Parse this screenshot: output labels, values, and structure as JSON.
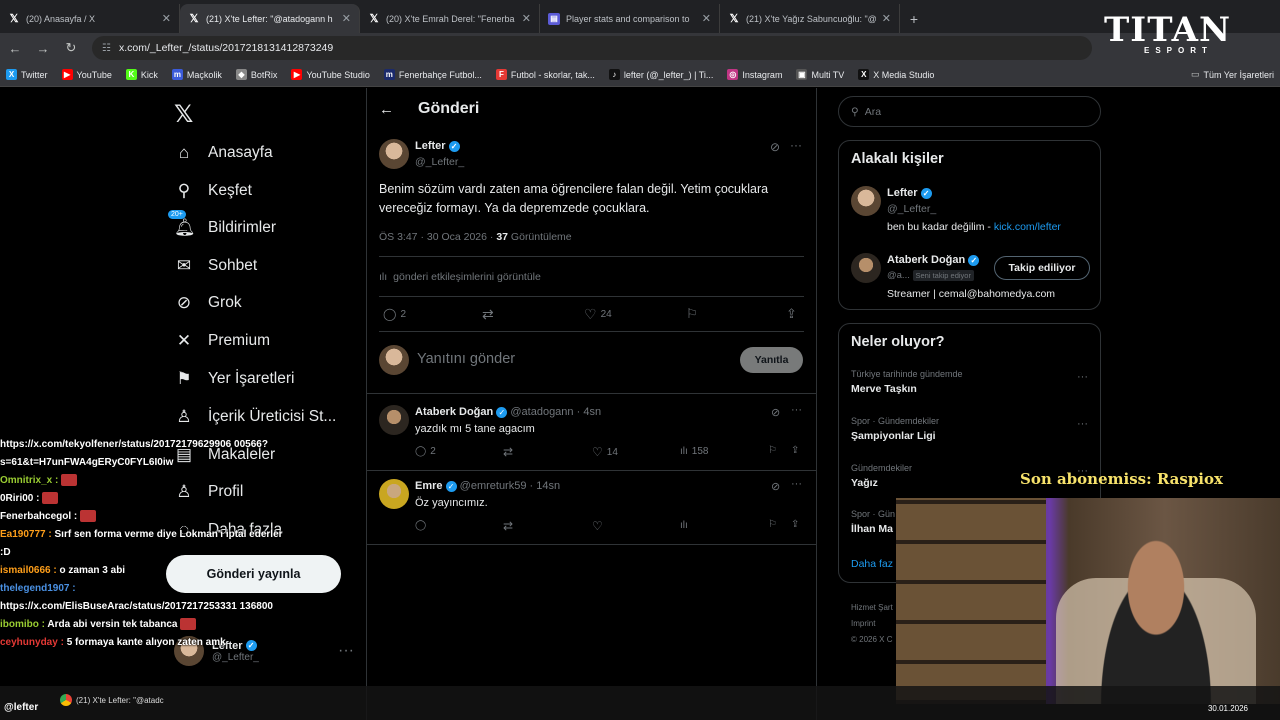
{
  "browser": {
    "tabs": [
      {
        "title": "(20) Anasayfa / X",
        "icon": "x-icon",
        "active": false
      },
      {
        "title": "(21) X'te Lefter: \"@atadogann h",
        "icon": "x-icon",
        "active": true
      },
      {
        "title": "(20) X'te Emrah Derel: \"Fenerba",
        "icon": "x-icon",
        "active": false
      },
      {
        "title": "Player stats and comparison to",
        "icon": "stats-icon",
        "active": false
      },
      {
        "title": "(21) X'te Yağız Sabuncuoğlu: \"@",
        "icon": "x-icon",
        "active": false
      }
    ],
    "url": "x.com/_Lefter_/status/2017218131412873249",
    "bookmarks": [
      {
        "label": "Twitter",
        "color": "#1d9bf0",
        "glyph": "X"
      },
      {
        "label": "YouTube",
        "color": "#ff0000",
        "glyph": "▶"
      },
      {
        "label": "Kick",
        "color": "#53fc18",
        "glyph": "K"
      },
      {
        "label": "Maçkolik",
        "color": "#3b5bdb",
        "glyph": "m"
      },
      {
        "label": "BotRix",
        "color": "#888888",
        "glyph": "◆"
      },
      {
        "label": "YouTube Studio",
        "color": "#ff0000",
        "glyph": "▶"
      },
      {
        "label": "Fenerbahçe Futbol...",
        "color": "#1b2a6b",
        "glyph": "m"
      },
      {
        "label": "Futbol - skorlar, tak...",
        "color": "#e53935",
        "glyph": "F"
      },
      {
        "label": "lefter (@_lefter_) | Ti...",
        "color": "#111111",
        "glyph": "♪"
      },
      {
        "label": "Instagram",
        "color": "#c13584",
        "glyph": "◎"
      },
      {
        "label": "Multi TV",
        "color": "#555555",
        "glyph": "▣"
      },
      {
        "label": "X Media Studio",
        "color": "#111111",
        "glyph": "X"
      }
    ],
    "bookmarks_all": "Tüm Yer İşaretleri"
  },
  "overlay_logo": {
    "main": "TITAN",
    "sub": "ESPORT"
  },
  "nav": {
    "items": [
      {
        "label": "Anasayfa",
        "icon": "home-icon",
        "glyph": "⌂"
      },
      {
        "label": "Keşfet",
        "icon": "search-icon",
        "glyph": "⚲"
      },
      {
        "label": "Bildirimler",
        "icon": "bell-icon",
        "glyph": "🔔︎",
        "badge": "20+"
      },
      {
        "label": "Sohbet",
        "icon": "mail-icon",
        "glyph": "✉"
      },
      {
        "label": "Grok",
        "icon": "grok-icon",
        "glyph": "⊘"
      },
      {
        "label": "Premium",
        "icon": "x-premium-icon",
        "glyph": "✕"
      },
      {
        "label": "Yer İşaretleri",
        "icon": "bookmark-icon",
        "glyph": "⚑"
      },
      {
        "label": "İçerik Üreticisi St...",
        "icon": "creator-icon",
        "glyph": "♙"
      },
      {
        "label": "Makaleler",
        "icon": "article-icon",
        "glyph": "▤"
      },
      {
        "label": "Profil",
        "icon": "profile-icon",
        "glyph": "♙"
      },
      {
        "label": "Daha fazla",
        "icon": "more-circle-icon",
        "glyph": "◌"
      }
    ],
    "post_button": "Gönderi yayınla",
    "account": {
      "name": "Lefter",
      "handle": "@_Lefter_"
    }
  },
  "main": {
    "header": "Gönderi",
    "post": {
      "name": "Lefter",
      "handle": "@_Lefter_",
      "text": "Benim sözüm vardı zaten ama öğrencilere falan değil. Yetim çocuklara vereceğiz formayı. Ya da depremzede çocuklara.",
      "time": "ÖS 3:47 · 30 Oca 2026 · ",
      "views": "37",
      "views_label": " Görüntüleme",
      "engagement_link": "gönderi etkileşimlerini görüntüle",
      "replies": "2",
      "likes": "24"
    },
    "reply_box": {
      "placeholder": "Yanıtını gönder",
      "button": "Yanıtla"
    },
    "replies": [
      {
        "name": "Ataberk Doğan",
        "handle": "@atadogann",
        "time": "· 4sn",
        "text": "yazdık mı 5 tane agacım",
        "replies": "2",
        "likes": "14",
        "views": "158"
      },
      {
        "name": "Emre",
        "handle": "@emreturk59",
        "time": "· 14sn",
        "text": "Öz yayıncımız.",
        "replies": "",
        "likes": "",
        "views": ""
      }
    ]
  },
  "right": {
    "search_placeholder": "Ara",
    "related": {
      "title": "Alakalı kişiler",
      "people": [
        {
          "name": "Lefter",
          "handle": "@_Lefter_",
          "bio": "ben bu kadar değilim - ",
          "link": "kick.com/lefter"
        },
        {
          "name": "Ataberk Doğan",
          "handle": "@a...",
          "follows_you": "Seni takip ediyor",
          "button": "Takip ediliyor",
          "bio": "Streamer | cemal@bahomedya.com"
        }
      ]
    },
    "trends": {
      "title": "Neler oluyor?",
      "items": [
        {
          "context": "Türkiye tarihinde gündemde",
          "name": "Merve Taşkın"
        },
        {
          "context": "Spor · Gündemdekiler",
          "name": "Şampiyonlar Ligi"
        },
        {
          "context": "Gündemdekiler",
          "name": "Yağız"
        },
        {
          "context": "Spor · Gün",
          "name": "İlhan Ma"
        }
      ],
      "show_more": "Daha faz"
    },
    "footer": [
      "Hizmet Şart",
      "Imprint",
      "© 2026 X C"
    ]
  },
  "chat": [
    {
      "user": "",
      "color": "#ffffff",
      "text": "https://x.com/tekyolfener/status/20172179629906 00566?s=61&t=H7unFWA4gERyC0FYL6I0iw"
    },
    {
      "user": "Omnitrix_x :",
      "color": "#9acd32",
      "text": "",
      "emote": true
    },
    {
      "user": "0Riri00 :",
      "color": "#ffffff",
      "text": "",
      "emote": true
    },
    {
      "user": "Fenerbahcegol :",
      "color": "#ffffff",
      "text": "",
      "emote": true
    },
    {
      "user": "Ea190777 :",
      "color": "#ff9f1a",
      "text": "Sırf sen forma verme diye Lokman'ı iptal ederler :D"
    },
    {
      "user": "ismail0666 :",
      "color": "#ff9f1a",
      "text": "o zaman 3 abi"
    },
    {
      "user": "thelegend1907 :",
      "color": "#4a90e2",
      "text": "https://x.com/ElisBuseArac/status/2017217253331 136800"
    },
    {
      "user": "ibomibo :",
      "color": "#9acd32",
      "text": "Arda abi versin tek tabanca",
      "emote": true
    },
    {
      "user": "ceyhunyday :",
      "color": "#e53935",
      "text": "5 formaya kante alıyon zaten amk"
    }
  ],
  "stream": {
    "sub_text": "Son abonemiss: Raspiox"
  },
  "taskbar": {
    "item": "(21) X'te Lefter: \"@atadc",
    "user": "@lefter",
    "date": "30.01.2026"
  }
}
